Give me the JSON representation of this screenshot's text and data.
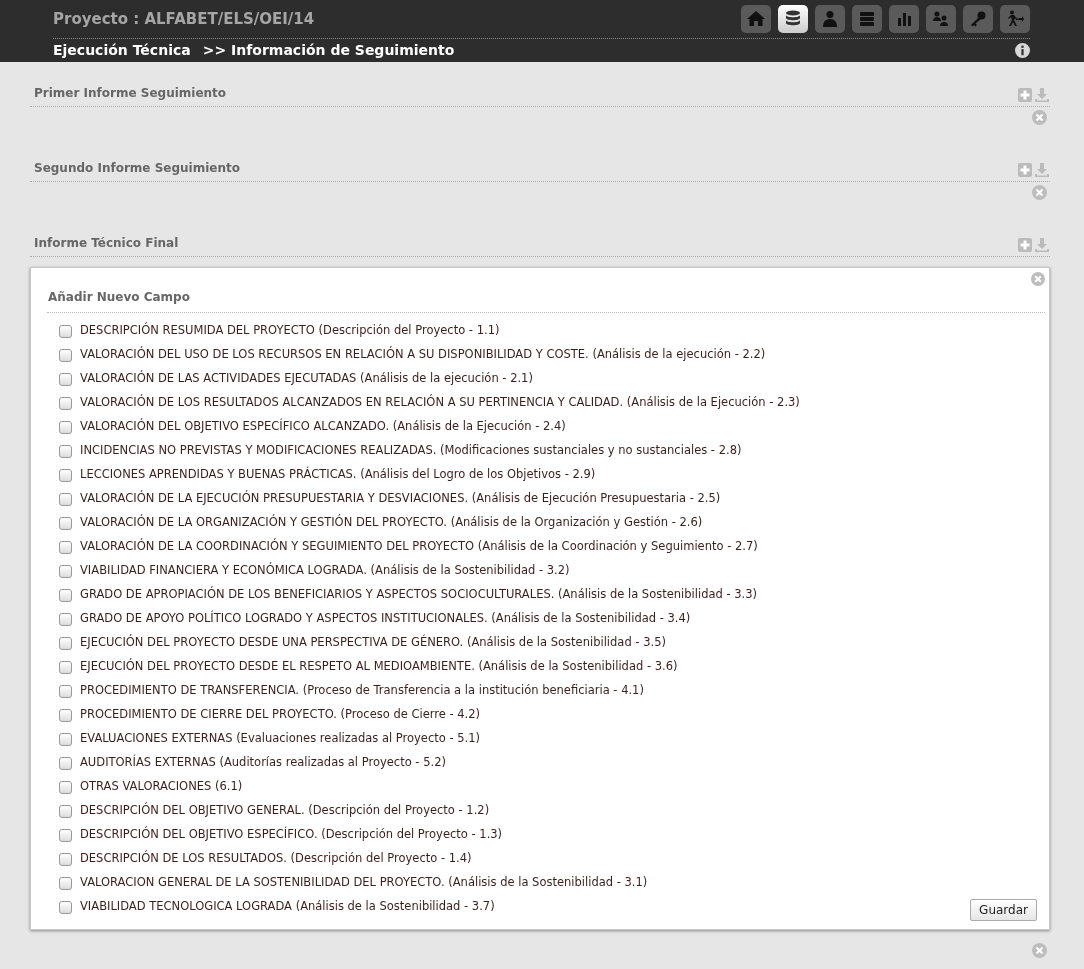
{
  "header": {
    "project_title": "Proyecto : ALFABET/ELS/OEI/14",
    "breadcrumb_section": "Ejecución Técnica",
    "breadcrumb_page": ">> Información de Seguimiento",
    "nav_icons": [
      {
        "kind": "home",
        "selected": false
      },
      {
        "kind": "database",
        "selected": true
      },
      {
        "kind": "user",
        "selected": false
      },
      {
        "kind": "stack",
        "selected": false
      },
      {
        "kind": "chart",
        "selected": false
      },
      {
        "kind": "users",
        "selected": false
      },
      {
        "kind": "key",
        "selected": false
      },
      {
        "kind": "exit",
        "selected": false
      }
    ]
  },
  "sections": [
    {
      "title": "Primer Informe Seguimiento"
    },
    {
      "title": "Segundo Informe Seguimiento"
    },
    {
      "title": "Informe Técnico Final",
      "form": {
        "title": "Añadir Nuevo Campo",
        "button": "Guardar",
        "items": [
          {
            "label": "DESCRIPCIÓN RESUMIDA DEL PROYECTO (Descripción del Proyecto - 1.1)",
            "checked": false
          },
          {
            "label": "VALORACIÓN DEL USO DE LOS RECURSOS EN RELACIÓN A SU DISPONIBILIDAD Y COSTE. (Análisis de la ejecución - 2.2)",
            "checked": false
          },
          {
            "label": "VALORACIÓN DE LAS ACTIVIDADES EJECUTADAS (Análisis de la ejecución - 2.1)",
            "checked": false
          },
          {
            "label": "VALORACIÓN DE LOS RESULTADOS ALCANZADOS EN RELACIÓN A SU PERTINENCIA Y CALIDAD. (Análisis de la Ejecución - 2.3)",
            "checked": false
          },
          {
            "label": "VALORACIÓN DEL OBJETIVO ESPECÍFICO ALCANZADO. (Análisis de la Ejecución - 2.4)",
            "checked": false
          },
          {
            "label": "INCIDENCIAS NO PREVISTAS Y MODIFICACIONES REALIZADAS. (Modificaciones sustanciales y no sustanciales - 2.8)",
            "checked": false
          },
          {
            "label": "LECCIONES APRENDIDAS Y BUENAS PRÁCTICAS. (Análisis del Logro de los Objetivos - 2.9)",
            "checked": false
          },
          {
            "label": "VALORACIÓN DE LA EJECUCIÓN PRESUPUESTARIA Y DESVIACIONES. (Análisis de Ejecución Presupuestaria - 2.5)",
            "checked": false
          },
          {
            "label": "VALORACIÓN DE LA ORGANIZACIÓN Y GESTIÓN DEL PROYECTO. (Análisis de la Organización y Gestión - 2.6)",
            "checked": false
          },
          {
            "label": "VALORACIÓN DE LA COORDINACIÓN Y SEGUIMIENTO DEL PROYECTO (Análisis de la Coordinación y Seguimiento - 2.7)",
            "checked": false
          },
          {
            "label": "VIABILIDAD FINANCIERA Y ECONÓMICA LOGRADA. (Análisis de la Sostenibilidad - 3.2)",
            "checked": false
          },
          {
            "label": "GRADO DE APROPIACIÓN DE LOS BENEFICIARIOS Y ASPECTOS SOCIOCULTURALES. (Análisis de la Sostenibilidad - 3.3)",
            "checked": false
          },
          {
            "label": "GRADO DE APOYO POLÍTICO LOGRADO Y ASPECTOS INSTITUCIONALES. (Análisis de la Sostenibilidad - 3.4)",
            "checked": false
          },
          {
            "label": "EJECUCIÓN DEL PROYECTO DESDE UNA PERSPECTIVA DE GÉNERO. (Análisis de la Sostenibilidad - 3.5)",
            "checked": false
          },
          {
            "label": "EJECUCIÓN DEL PROYECTO DESDE EL RESPETO AL MEDIOAMBIENTE. (Análisis de la Sostenibilidad - 3.6)",
            "checked": false
          },
          {
            "label": "PROCEDIMIENTO DE TRANSFERENCIA. (Proceso de Transferencia a la institución beneficiaria - 4.1)",
            "checked": false
          },
          {
            "label": "PROCEDIMIENTO DE CIERRE DEL PROYECTO. (Proceso de Cierre - 4.2)",
            "checked": false
          },
          {
            "label": "EVALUACIONES EXTERNAS (Evaluaciones realizadas al Proyecto - 5.1)",
            "checked": false
          },
          {
            "label": "AUDITORÍAS EXTERNAS (Auditorías realizadas al Proyecto - 5.2)",
            "checked": false
          },
          {
            "label": "OTRAS VALORACIONES (6.1)",
            "checked": false
          },
          {
            "label": "DESCRIPCIÓN DEL OBJETIVO GENERAL. (Descripción del Proyecto - 1.2)",
            "checked": false
          },
          {
            "label": "DESCRIPCIÓN DEL OBJETIVO ESPECÍFICO. (Descripción del Proyecto - 1.3)",
            "checked": false
          },
          {
            "label": "DESCRIPCIÓN DE LOS RESULTADOS. (Descripción del Proyecto - 1.4)",
            "checked": false
          },
          {
            "label": "VALORACION GENERAL DE LA SOSTENIBILIDAD DEL PROYECTO. (Análisis de la Sostenibilidad - 3.1)",
            "checked": false
          },
          {
            "label": "VIABILIDAD TECNOLOGICA LOGRADA (Análisis de la Sostenibilidad - 3.7)",
            "checked": false
          }
        ]
      }
    }
  ]
}
